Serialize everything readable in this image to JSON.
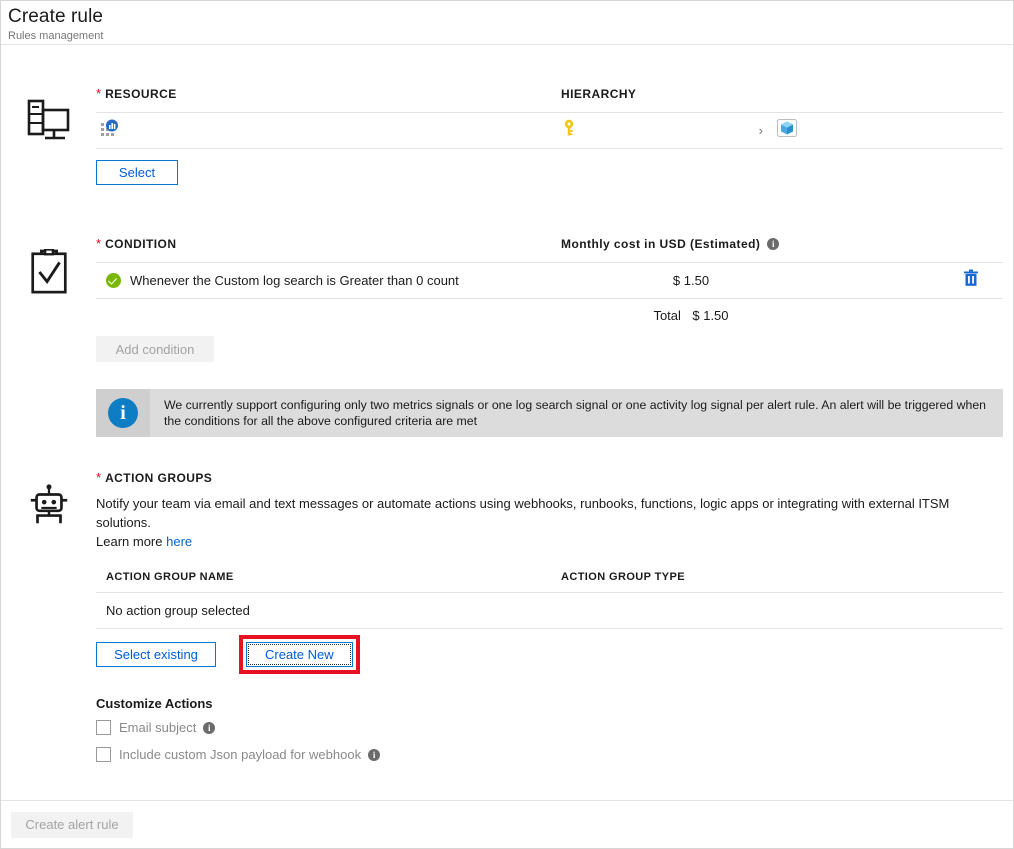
{
  "header": {
    "title": "Create rule",
    "subtitle": "Rules management"
  },
  "resource": {
    "icon": "monitor-server-icon",
    "label": "RESOURCE",
    "required_marker": "*",
    "hierarchy_label": "HIERARCHY",
    "row": {
      "resource_icon": "log-analytics-workspace-icon",
      "subscription_icon": "key-icon",
      "separator_icon": "chevron-right-icon",
      "resource_group_icon": "resource-group-cube-icon"
    },
    "select_button": "Select"
  },
  "condition": {
    "icon": "clipboard-check-icon",
    "label": "CONDITION",
    "required_marker": "*",
    "cost_header": "Monthly cost in USD (Estimated)",
    "cost_header_info": "i",
    "rows": [
      {
        "status_icon": "green-check-icon",
        "text": "Whenever the Custom log search is Greater than 0 count",
        "cost": "$ 1.50",
        "delete_icon": "trash-icon"
      }
    ],
    "total_label": "Total",
    "total_value": "$ 1.50",
    "add_condition_button": "Add condition",
    "info_banner": {
      "icon": "info-circle-icon",
      "text": "We currently support configuring only two metrics signals or one log search signal or one activity log signal per alert rule. An alert will be triggered when the conditions for all the above configured criteria are met"
    }
  },
  "action_groups": {
    "icon": "robot-icon",
    "label": "ACTION GROUPS",
    "required_marker": "*",
    "description": "Notify your team via email and text messages or automate actions using webhooks, runbooks, functions, logic apps or integrating with external ITSM solutions.",
    "learn_more_prefix": "Learn more",
    "learn_more_link": "here",
    "table": {
      "columns": [
        "ACTION GROUP NAME",
        "ACTION GROUP TYPE"
      ],
      "empty_text": "No action group selected"
    },
    "select_existing_button": "Select existing",
    "create_new_button": "Create New",
    "highlight_color": "#e81123"
  },
  "customize_actions": {
    "title": "Customize Actions",
    "items": [
      {
        "label": "Email subject",
        "checked": false,
        "info_icon": "i"
      },
      {
        "label": "Include custom Json payload for webhook",
        "checked": false,
        "info_icon": "i"
      }
    ]
  },
  "footer": {
    "create_button": "Create alert rule"
  },
  "colors": {
    "accent": "#0078d4",
    "link": "#0066cc",
    "required": "#e00b1c",
    "success": "#7ab800",
    "highlight": "#e81123"
  }
}
